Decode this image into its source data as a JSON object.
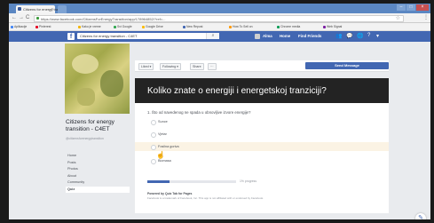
{
  "browser": {
    "tab_title": "Citizens for energy tran",
    "tab_close": "×",
    "url": "https://www.facebook.com/CitizensForEnergyTransition/app/178964852/?ref=...",
    "star": "☆",
    "menu": "⋮",
    "back": "←",
    "forward": "→",
    "reload": "C",
    "window_controls": [
      "–",
      "□",
      "×"
    ],
    "bookmarks": [
      "Aplikacije",
      "Pinterest",
      "Kako je vreme",
      "Svi Google",
      "Google Drive",
      "New Repost",
      "How To Sell on",
      "Chrome media",
      "Web Signal"
    ]
  },
  "facebook": {
    "logo": "f",
    "search_value": "Citizens for energy transition - C4ET",
    "search_button_icon": "⌕",
    "user_name": "Alma",
    "home_link": "Home",
    "find_friends_link": "Find Friends",
    "top_icons": [
      "👥",
      "💬",
      "🌐",
      "?",
      "▾"
    ]
  },
  "sidebar": {
    "page_name": "Citizens for energy transition - C4ET",
    "page_handle": "@citizensforenergytransition",
    "nav_items": [
      {
        "label": "Home"
      },
      {
        "label": "Posts"
      },
      {
        "label": "Photos"
      },
      {
        "label": "About"
      },
      {
        "label": "Community"
      },
      {
        "label": "Quiz"
      }
    ]
  },
  "actions": {
    "liked": "Liked ▾",
    "following": "Following ▾",
    "share": "Share",
    "more": "···",
    "send_message": "Send Message"
  },
  "quiz": {
    "title": "Koliko znate o energiji i energetskoj tranziciji?",
    "question": "1. Što od navedenog ne spada u obnovljive izvore energije?",
    "options": [
      {
        "label": "Sunce"
      },
      {
        "label": "Vjetar"
      },
      {
        "label": "Fosilna goriva"
      },
      {
        "label": "Biomasa"
      }
    ],
    "hovered_option_index": 2,
    "progress": 0.25,
    "progress_label": "1% progress",
    "footer_title": "Powered by Quiz Tab for Pages",
    "footer_text": "Facebook is a trademark of Facebook, Inc. This app is not affiliated with or endorsed by Facebook."
  },
  "colors": {
    "brand": "#4267b2",
    "quiz_header": "#232323",
    "hover_row": "#fbf3e4"
  }
}
